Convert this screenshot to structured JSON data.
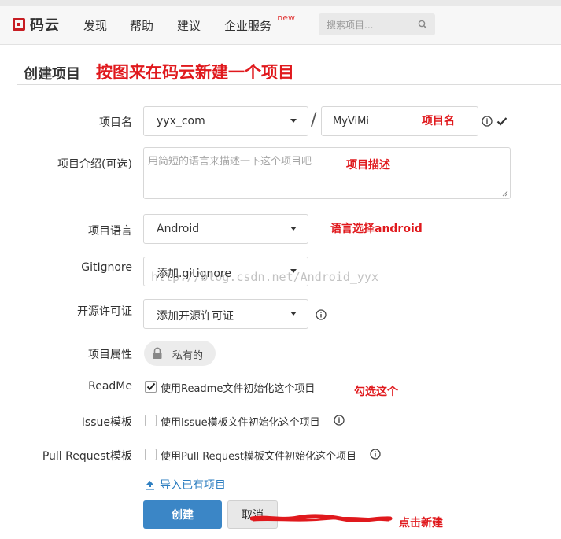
{
  "colors": {
    "brand": "#c71d23",
    "annotation": "#e0191d",
    "primary_button": "#3b86c6",
    "link": "#2f7fc1"
  },
  "nav": {
    "logo_text": "码云",
    "items": [
      {
        "label": "发现"
      },
      {
        "label": "帮助"
      },
      {
        "label": "建议"
      },
      {
        "label": "企业服务",
        "badge": "new"
      }
    ],
    "search_placeholder": "搜索项目...",
    "search_icon": "search-icon"
  },
  "header": {
    "title": "创建项目",
    "annotation": "按图来在码云新建一个项目"
  },
  "form": {
    "name": {
      "label": "项目名",
      "owner_value": "yyx_com",
      "separator": "/",
      "project_value": "MyViMi",
      "annotation": "项目名"
    },
    "description": {
      "label": "项目介绍(可选)",
      "placeholder": "用简短的语言来描述一下这个项目吧",
      "annotation": "项目描述"
    },
    "language": {
      "label": "项目语言",
      "value": "Android",
      "annotation": "语言选择android"
    },
    "gitignore": {
      "label": "GitIgnore",
      "value": "添加.gitignore"
    },
    "license": {
      "label": "开源许可证",
      "value": "添加开源许可证"
    },
    "visibility": {
      "label": "项目属性",
      "value": "私有的"
    },
    "readme": {
      "label": "ReadMe",
      "checked": true,
      "text": "使用Readme文件初始化这个项目",
      "annotation": "勾选这个"
    },
    "issue": {
      "label": "Issue模板",
      "checked": false,
      "text": "使用Issue模板文件初始化这个项目"
    },
    "pull_request": {
      "label": "Pull Request模板",
      "checked": false,
      "text": "使用Pull Request模板文件初始化这个项目"
    },
    "import_link": "导入已有项目",
    "create_button": "创建",
    "cancel_button": "取消",
    "create_annotation": "点击新建"
  },
  "watermark": "http://blog.csdn.net/Android_yyx"
}
